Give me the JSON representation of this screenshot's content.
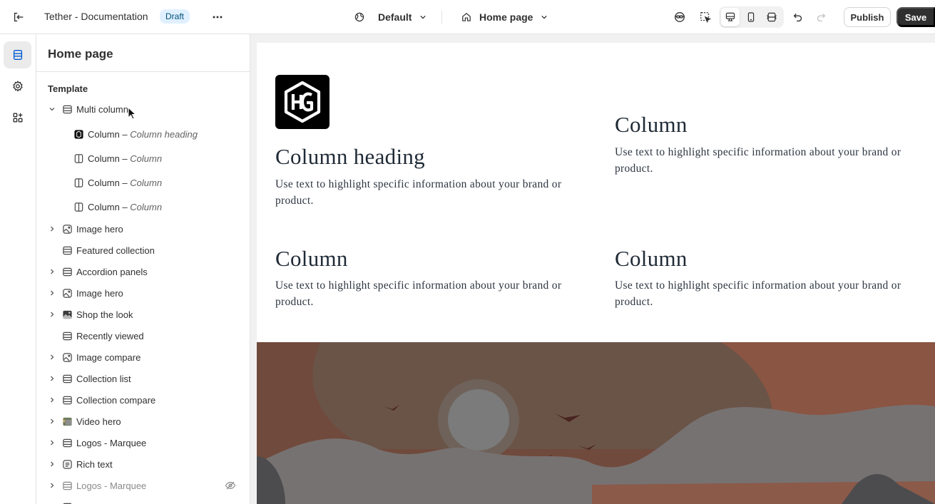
{
  "topbar": {
    "exit_icon": "exit-icon",
    "title": "Tether - Documentation",
    "status_badge": "Draft",
    "more_icon": "more-horizontal-icon",
    "theme_selector": {
      "icon": "globe-icon",
      "label": "Default"
    },
    "page_selector": {
      "icon": "home-icon",
      "label": "Home page"
    },
    "tools": [
      "inspector-icon",
      "select-element-icon"
    ],
    "viewports": [
      "desktop-icon",
      "mobile-icon",
      "fullwidth-icon"
    ],
    "active_viewport": "desktop",
    "undo_icon": "undo-icon",
    "redo_icon": "redo-icon",
    "publish_label": "Publish",
    "save_label": "Save"
  },
  "rail": {
    "items": [
      "sections-icon",
      "settings-icon",
      "apps-icon"
    ],
    "active": "sections"
  },
  "sidebar": {
    "title": "Home page",
    "section_label": "Template",
    "tree": [
      {
        "label": "Multi column",
        "expanded": true,
        "icon": "section-icon",
        "children": [
          {
            "label": "Column",
            "sub": "Column heading",
            "icon": "logo-thumb-icon"
          },
          {
            "label": "Column",
            "sub": "Column",
            "icon": "column-icon"
          },
          {
            "label": "Column",
            "sub": "Column",
            "icon": "column-icon"
          },
          {
            "label": "Column",
            "sub": "Column",
            "icon": "column-icon"
          }
        ]
      },
      {
        "label": "Image hero",
        "icon": "image-icon",
        "expandable": true
      },
      {
        "label": "Featured collection",
        "icon": "section-icon",
        "expandable": false
      },
      {
        "label": "Accordion panels",
        "icon": "section-icon",
        "expandable": true
      },
      {
        "label": "Image hero",
        "icon": "image-icon",
        "expandable": true
      },
      {
        "label": "Shop the look",
        "icon": "photo-thumb-icon",
        "expandable": true
      },
      {
        "label": "Recently viewed",
        "icon": "section-icon",
        "expandable": false
      },
      {
        "label": "Image compare",
        "icon": "image-icon",
        "expandable": true
      },
      {
        "label": "Collection list",
        "icon": "section-icon",
        "expandable": true
      },
      {
        "label": "Collection compare",
        "icon": "section-icon",
        "expandable": true
      },
      {
        "label": "Video hero",
        "icon": "video-thumb-icon",
        "expandable": true
      },
      {
        "label": "Logos - Marquee",
        "icon": "section-icon",
        "expandable": true
      },
      {
        "label": "Rich text",
        "icon": "text-icon",
        "expandable": true
      },
      {
        "label": "Logos - Marquee",
        "icon": "section-icon",
        "expandable": true,
        "hidden": true
      }
    ]
  },
  "preview": {
    "columns": [
      {
        "heading": "Column heading",
        "text": "Use text to highlight specific information about your brand or product.",
        "has_logo": true
      },
      {
        "heading": "Column",
        "text": "Use text to highlight specific information about your brand or product."
      },
      {
        "heading": "Column",
        "text": "Use text to highlight specific information about your brand or product."
      },
      {
        "heading": "Column",
        "text": "Use text to highlight specific information about your brand or product."
      }
    ],
    "hero": {
      "background": "#704a3c",
      "illustration": "sunset-landscape-illustration"
    }
  },
  "colors": {
    "accent_dark": "#303030",
    "badge_bg": "#e0f0ff",
    "badge_text": "#00527c",
    "heading_text": "#1f2a36"
  }
}
